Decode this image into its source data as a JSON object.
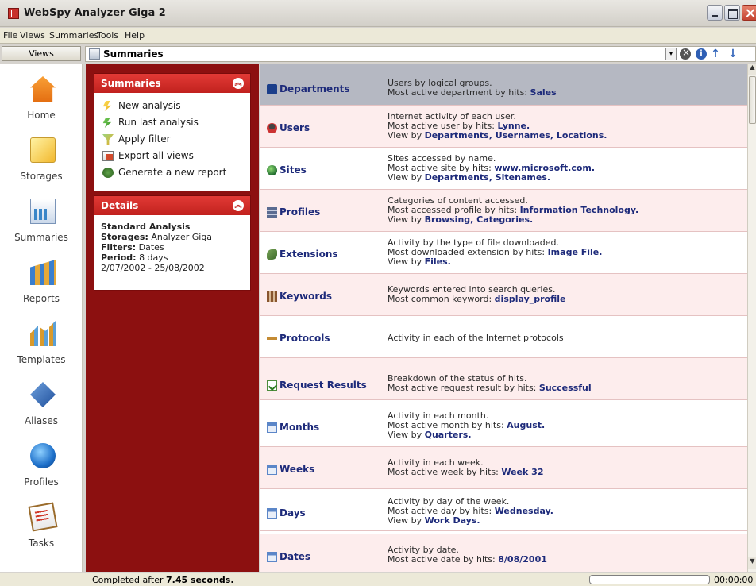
{
  "window": {
    "title": "WebSpy Analyzer Giga 2"
  },
  "menu": [
    "File",
    "Views",
    "Summaries",
    "Tools",
    "Help"
  ],
  "views_tab": "Views",
  "header": {
    "title": "Summaries"
  },
  "sidebar": [
    {
      "label": "Home",
      "icon": "home-icon"
    },
    {
      "label": "Storages",
      "icon": "storages-icon"
    },
    {
      "label": "Summaries",
      "icon": "summaries-icon"
    },
    {
      "label": "Reports",
      "icon": "reports-icon"
    },
    {
      "label": "Templates",
      "icon": "templates-icon"
    },
    {
      "label": "Aliases",
      "icon": "aliases-icon"
    },
    {
      "label": "Profiles",
      "icon": "profiles-icon"
    },
    {
      "label": "Tasks",
      "icon": "tasks-icon"
    }
  ],
  "summaries_box": {
    "title": "Summaries",
    "tasks": [
      "New analysis",
      "Run last analysis",
      "Apply filter",
      "Export all views",
      "Generate a new report"
    ]
  },
  "details_box": {
    "title": "Details",
    "name": "Standard Analysis",
    "storages_label": "Storages:",
    "storages_value": "Analyzer Giga",
    "filters_label": "Filters:",
    "filters_value": "Dates",
    "period_label": "Period:",
    "period_value": "8 days",
    "date_range": "2/07/2002 - 25/08/2002"
  },
  "rows": [
    {
      "name": "Departments",
      "l1": "Users by logical groups.",
      "l2a": "Most active department by hits: ",
      "l2b": "Sales",
      "l3a": "",
      "l3b": ""
    },
    {
      "name": "Users",
      "l1": "Internet activity of each user.",
      "l2a": "Most active user by hits: ",
      "l2b": "Lynne.",
      "l3a": "View by ",
      "l3b": "Departments, Usernames, Locations."
    },
    {
      "name": "Sites",
      "l1": "Sites accessed by name.",
      "l2a": "Most active site by hits: ",
      "l2b": "www.microsoft.com.",
      "l3a": "View by ",
      "l3b": "Departments, Sitenames."
    },
    {
      "name": "Profiles",
      "l1": "Categories of content accessed.",
      "l2a": "Most accessed profile by hits: ",
      "l2b": "Information Technology.",
      "l3a": "View by ",
      "l3b": "Browsing, Categories."
    },
    {
      "name": "Extensions",
      "l1": "Activity by the type of file downloaded.",
      "l2a": "Most downloaded extension by hits: ",
      "l2b": "Image File.",
      "l3a": "View by ",
      "l3b": "Files."
    },
    {
      "name": "Keywords",
      "l1": "Keywords entered into search queries.",
      "l2a": "Most common keyword: ",
      "l2b": "display_profile",
      "l3a": "",
      "l3b": ""
    },
    {
      "name": "Protocols",
      "l1": "Activity in each of the Internet protocols",
      "l2a": "",
      "l2b": "",
      "l3a": "",
      "l3b": ""
    },
    {
      "name": "Request Results",
      "l1": "Breakdown of the status of hits.",
      "l2a": "Most active request result by hits: ",
      "l2b": "Successful",
      "l3a": "",
      "l3b": ""
    },
    {
      "name": "Months",
      "l1": "Activity in each month.",
      "l2a": "Most active month by hits: ",
      "l2b": "August.",
      "l3a": "View by ",
      "l3b": "Quarters."
    },
    {
      "name": "Weeks",
      "l1": "Activity in each week.",
      "l2a": "Most active week by hits: ",
      "l2b": "Week 32",
      "l3a": "",
      "l3b": ""
    },
    {
      "name": "Days",
      "l1": "Activity by day of the week.",
      "l2a": "Most active day by hits: ",
      "l2b": "Wednesday.",
      "l3a": "View by ",
      "l3b": "Work Days."
    },
    {
      "name": "Dates",
      "l1": "Activity by date.",
      "l2a": "Most active date by hits: ",
      "l2b": "8/08/2001",
      "l3a": "",
      "l3b": ""
    }
  ],
  "status": {
    "text": "Completed after ",
    "time": "7.45 seconds.",
    "timer": "00:00:00",
    "progress": 0
  },
  "colors": {
    "accent": "#c1211e",
    "panel": "#8c1010",
    "link": "#1d2a7a",
    "row_alt": "#fdeded",
    "selected": "#b5b8c2"
  }
}
